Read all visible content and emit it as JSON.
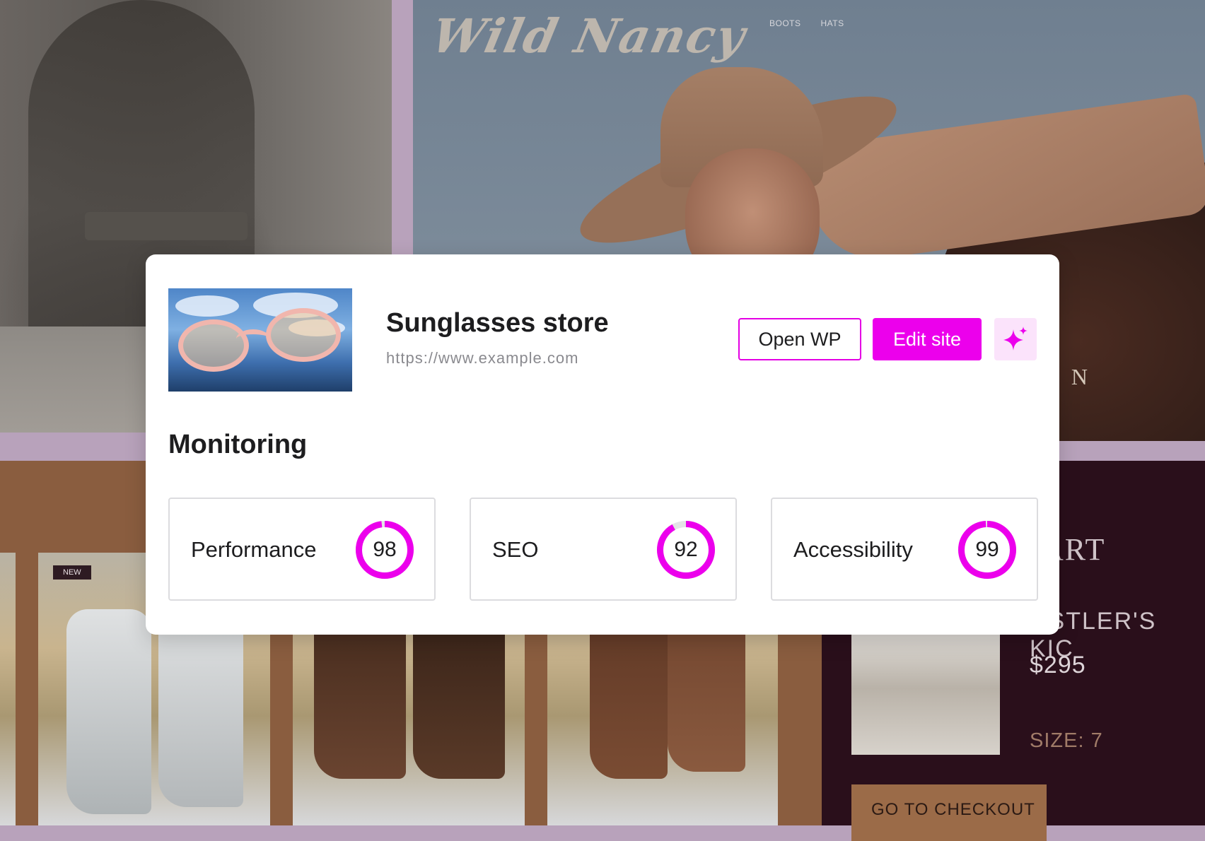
{
  "background_site": {
    "logo": "Wild Nancy",
    "nav": [
      "BOOTS",
      "HATS"
    ],
    "hero_letter": "N",
    "badge": "NEW",
    "cart": {
      "title": "ART",
      "product": "USTLER'S KIC",
      "price": "$295",
      "size": "SIZE: 7",
      "checkout": "GO TO CHECKOUT"
    }
  },
  "site_card": {
    "title": "Sunglasses store",
    "url": "https://www.example.com",
    "thumbnail_icon": "sunglasses-photo",
    "buttons": {
      "open_wp": "Open WP",
      "edit_site": "Edit site",
      "ai_icon": "sparkle-icon"
    },
    "monitoring": {
      "heading": "Monitoring",
      "metrics": [
        {
          "label": "Performance",
          "score": 98
        },
        {
          "label": "SEO",
          "score": 92
        },
        {
          "label": "Accessibility",
          "score": 99
        }
      ]
    }
  },
  "colors": {
    "accent": "#ec00ec",
    "accent_light": "#fbe3fb",
    "gauge_track": "#e4e4e6"
  }
}
